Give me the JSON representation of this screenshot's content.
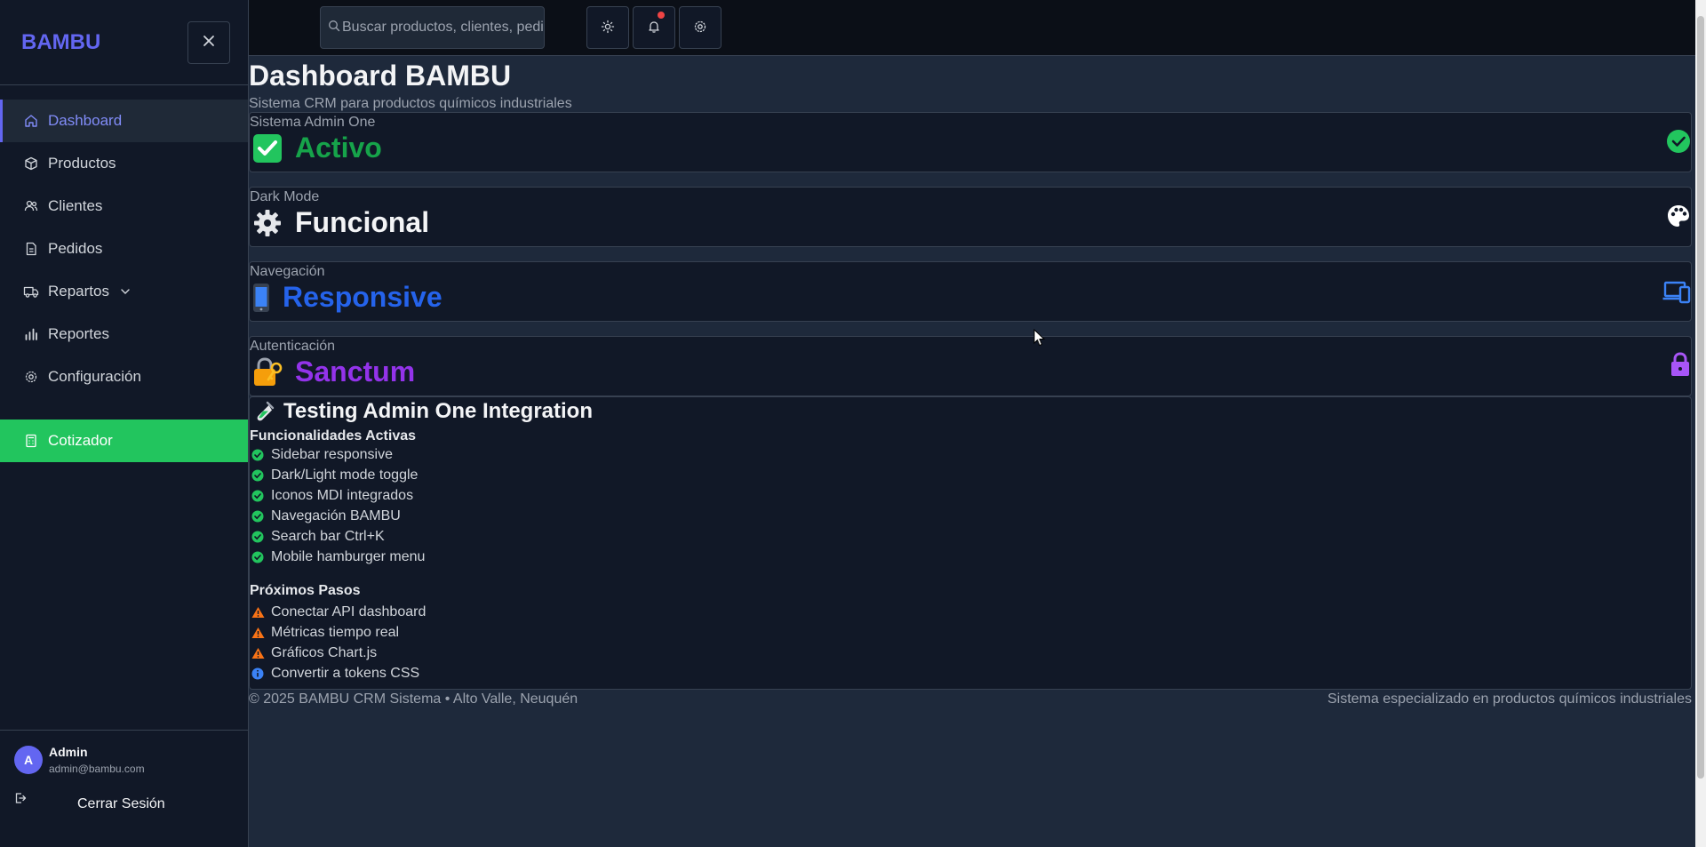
{
  "brand": "BAMBU",
  "sidebar": {
    "items": [
      {
        "label": "Dashboard"
      },
      {
        "label": "Productos"
      },
      {
        "label": "Clientes"
      },
      {
        "label": "Pedidos"
      },
      {
        "label": "Repartos"
      },
      {
        "label": "Reportes"
      },
      {
        "label": "Configuración"
      }
    ],
    "cta": {
      "label": "Cotizador"
    },
    "user": {
      "initial": "A",
      "name": "Admin",
      "email": "admin@bambu.com"
    },
    "logout_label": "Cerrar Sesión"
  },
  "topbar": {
    "search_placeholder": "Buscar productos, clientes, pedidos... (Ctrl+K)"
  },
  "main": {
    "title": "Dashboard BAMBU",
    "subtitle": "Sistema CRM para productos químicos industriales",
    "cards": [
      {
        "label": "Sistema Admin One",
        "emoji": "✅",
        "value": "Activo",
        "color": "#16a34a",
        "icon": "check-circle-icon",
        "icon_color": "#22c55e"
      },
      {
        "label": "Dark Mode",
        "emoji": "⚙️",
        "value": "Funcional",
        "color": "#f3f4f6",
        "icon": "palette-icon",
        "icon_color": "#ffffff"
      },
      {
        "label": "Navegación",
        "emoji": "📱",
        "value": "Responsive",
        "color": "#2563eb",
        "icon": "devices-icon",
        "icon_color": "#3b82f6"
      },
      {
        "label": "Autenticación",
        "emoji": "🔐",
        "value": "Sanctum",
        "color": "#9333ea",
        "icon": "lock-icon",
        "icon_color": "#a855f7"
      }
    ],
    "testing": {
      "emoji": "🧪",
      "title": "Testing Admin One Integration",
      "active_title": "Funcionalidades Activas",
      "active": [
        "Sidebar responsive",
        "Dark/Light mode toggle",
        "Iconos MDI integrados",
        "Navegación BAMBU",
        "Search bar Ctrl+K",
        "Mobile hamburger menu"
      ],
      "next_title": "Próximos Pasos",
      "next": [
        {
          "text": "Conectar API dashboard",
          "kind": "warning"
        },
        {
          "text": "Métricas tiempo real",
          "kind": "warning"
        },
        {
          "text": "Gráficos Chart.js",
          "kind": "warning"
        },
        {
          "text": "Convertir a tokens CSS",
          "kind": "info"
        }
      ]
    },
    "footer": {
      "left": "© 2025 BAMBU CRM Sistema • Alto Valle, Neuquén",
      "right": "Sistema especializado en productos químicos industriales"
    }
  },
  "colors": {
    "accent": "#6366f1",
    "cta": "#22c55e",
    "success": "#22c55e",
    "warning": "#f97316",
    "info": "#3b82f6",
    "notification": "#ef4444"
  }
}
